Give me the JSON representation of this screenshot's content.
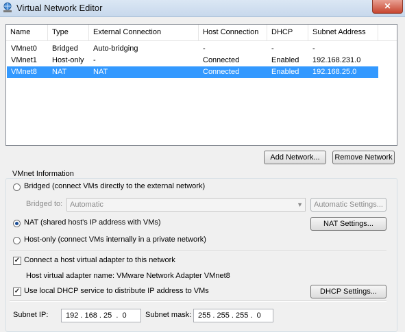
{
  "window": {
    "title": "Virtual Network Editor",
    "close_label": "✕"
  },
  "table": {
    "columns": [
      "Name",
      "Type",
      "External Connection",
      "Host Connection",
      "DHCP",
      "Subnet Address"
    ],
    "rows": [
      [
        "VMnet0",
        "Bridged",
        "Auto-bridging",
        "-",
        "-",
        "-"
      ],
      [
        "VMnet1",
        "Host-only",
        "-",
        "Connected",
        "Enabled",
        "192.168.231.0"
      ],
      [
        "VMnet8",
        "NAT",
        "NAT",
        "Connected",
        "Enabled",
        "192.168.25.0"
      ]
    ],
    "selected_row": 2
  },
  "buttons": {
    "add_network": "Add Network...",
    "remove_network": "Remove Network",
    "automatic_settings": "Automatic Settings...",
    "nat_settings": "NAT Settings...",
    "dhcp_settings": "DHCP Settings..."
  },
  "vmnet_info": {
    "group_label": "VMnet Information",
    "bridged_label": "Bridged (connect VMs directly to the external network)",
    "bridged_to_label": "Bridged to:",
    "bridged_to_value": "Automatic",
    "nat_label": "NAT (shared host's IP address with VMs)",
    "hostonly_label": "Host-only (connect VMs internally in a private network)",
    "selected_mode": "NAT",
    "connect_adapter_label": "Connect a host virtual adapter to this network",
    "connect_adapter_checked": true,
    "adapter_name_label": "Host virtual adapter name: VMware Network Adapter VMnet8",
    "dhcp_label": "Use local DHCP service to distribute IP address to VMs",
    "dhcp_checked": true,
    "subnet_ip_label": "Subnet IP:",
    "subnet_ip_value": "192 . 168 . 25  .  0",
    "subnet_mask_label": "Subnet mask:",
    "subnet_mask_value": "255 . 255 . 255 .  0"
  },
  "colors": {
    "selection": "#3399ff",
    "title_bar": "#c7d8ec",
    "close_button": "#c7452f"
  },
  "icons": {
    "app": "network-globe-icon",
    "combo_arrow": "chevron-down-icon"
  }
}
